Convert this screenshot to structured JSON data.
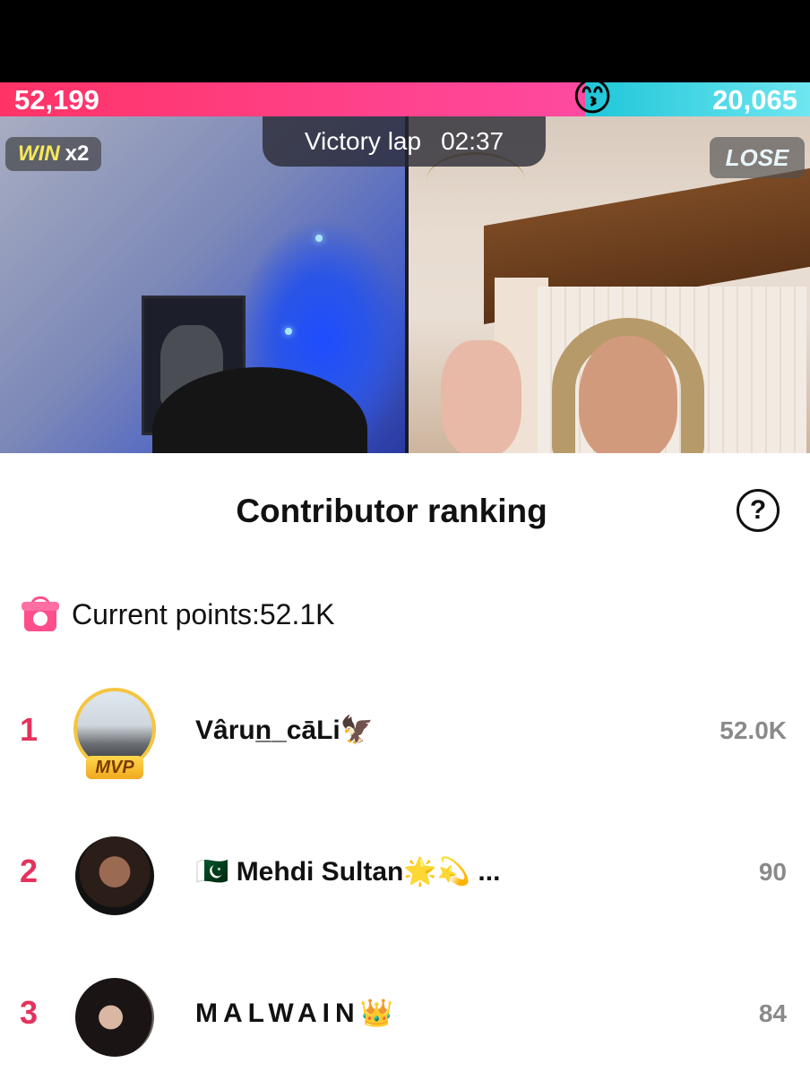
{
  "battle": {
    "left_score": "52,199",
    "right_score": "20,065",
    "center_emoji": "😙",
    "left_share": 0.7224,
    "win_word": "WIN",
    "win_multiplier": "x2",
    "timer_label": "Victory lap",
    "timer_value": "02:37",
    "lose_label": "LOSE",
    "colors": {
      "left": "#ff3366",
      "right": "#1fc6d8"
    }
  },
  "sheet": {
    "title": "Contributor ranking",
    "help_icon": "?",
    "current_points": "Current points:52.1K"
  },
  "ranking": [
    {
      "rank": "1",
      "name": "Vârun̲_cāLi🦅",
      "score": "52.0K",
      "badge": "MVP"
    },
    {
      "rank": "2",
      "name": "🇵🇰 Mehdi Sultan🌟💫 ...",
      "score": "90"
    },
    {
      "rank": "3",
      "name": "MALWAIN👑",
      "score": "84"
    }
  ]
}
